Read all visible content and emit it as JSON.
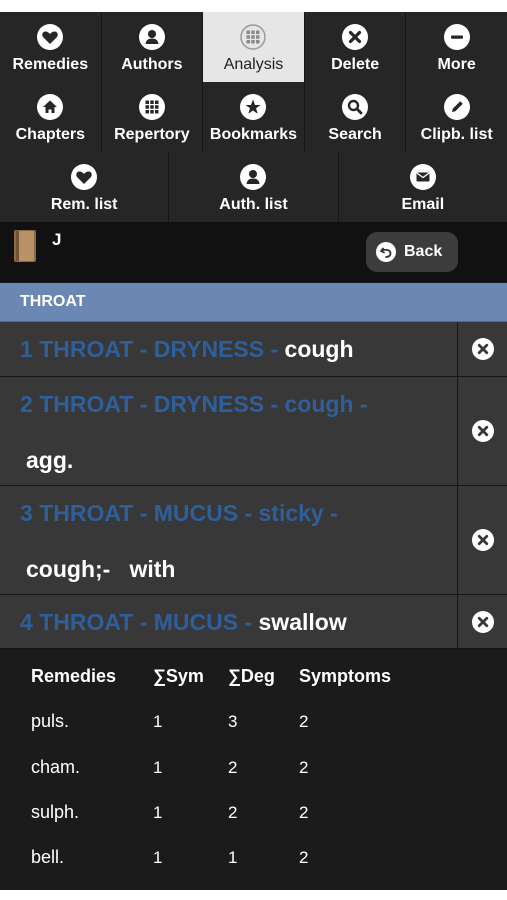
{
  "toolbar": {
    "rows": [
      [
        {
          "label": "Remedies",
          "icon": "heart-icon",
          "active": false
        },
        {
          "label": "Authors",
          "icon": "person-icon",
          "active": false
        },
        {
          "label": "Analysis",
          "icon": "grid-icon",
          "active": true
        },
        {
          "label": "Delete",
          "icon": "close-icon",
          "active": false
        },
        {
          "label": "More",
          "icon": "minus-icon",
          "active": false
        }
      ],
      [
        {
          "label": "Chapters",
          "icon": "home-icon"
        },
        {
          "label": "Repertory",
          "icon": "grid-icon"
        },
        {
          "label": "Bookmarks",
          "icon": "star-icon"
        },
        {
          "label": "Search",
          "icon": "search-icon"
        },
        {
          "label": "Clipb. list",
          "icon": "pencil-icon"
        }
      ],
      [
        {
          "label": "Rem. list",
          "icon": "heart-icon"
        },
        {
          "label": "Auth. list",
          "icon": "person-icon"
        },
        {
          "label": "Email",
          "icon": "mail-icon"
        }
      ]
    ]
  },
  "session": {
    "letter": "J",
    "back_label": "Back"
  },
  "section": {
    "title": "THROAT"
  },
  "rubrics": [
    {
      "number": "1",
      "path": "THROAT - DRYNESS -",
      "highlight": "cough",
      "line2": ""
    },
    {
      "number": "2",
      "path": "THROAT - DRYNESS - cough -",
      "highlight": "",
      "line2": "agg."
    },
    {
      "number": "3",
      "path": "THROAT - MUCUS - sticky -",
      "highlight": "",
      "line2": "cough;-   with"
    },
    {
      "number": "4",
      "path": "THROAT - MUCUS -",
      "highlight": "swallow",
      "line2": ""
    }
  ],
  "analysis_table": {
    "headers": [
      "Remedies",
      "∑Sym",
      "∑Deg",
      "Symptoms"
    ],
    "rows": [
      [
        "puls.",
        "1",
        "3",
        "2"
      ],
      [
        "cham.",
        "1",
        "2",
        "2"
      ],
      [
        "sulph.",
        "1",
        "2",
        "2"
      ],
      [
        "bell.",
        "1",
        "1",
        "2"
      ]
    ]
  },
  "colors": {
    "accent_header": "#6a88b3",
    "rubric_path": "#2f5f9b",
    "active_tab": "#e6e6e6"
  }
}
